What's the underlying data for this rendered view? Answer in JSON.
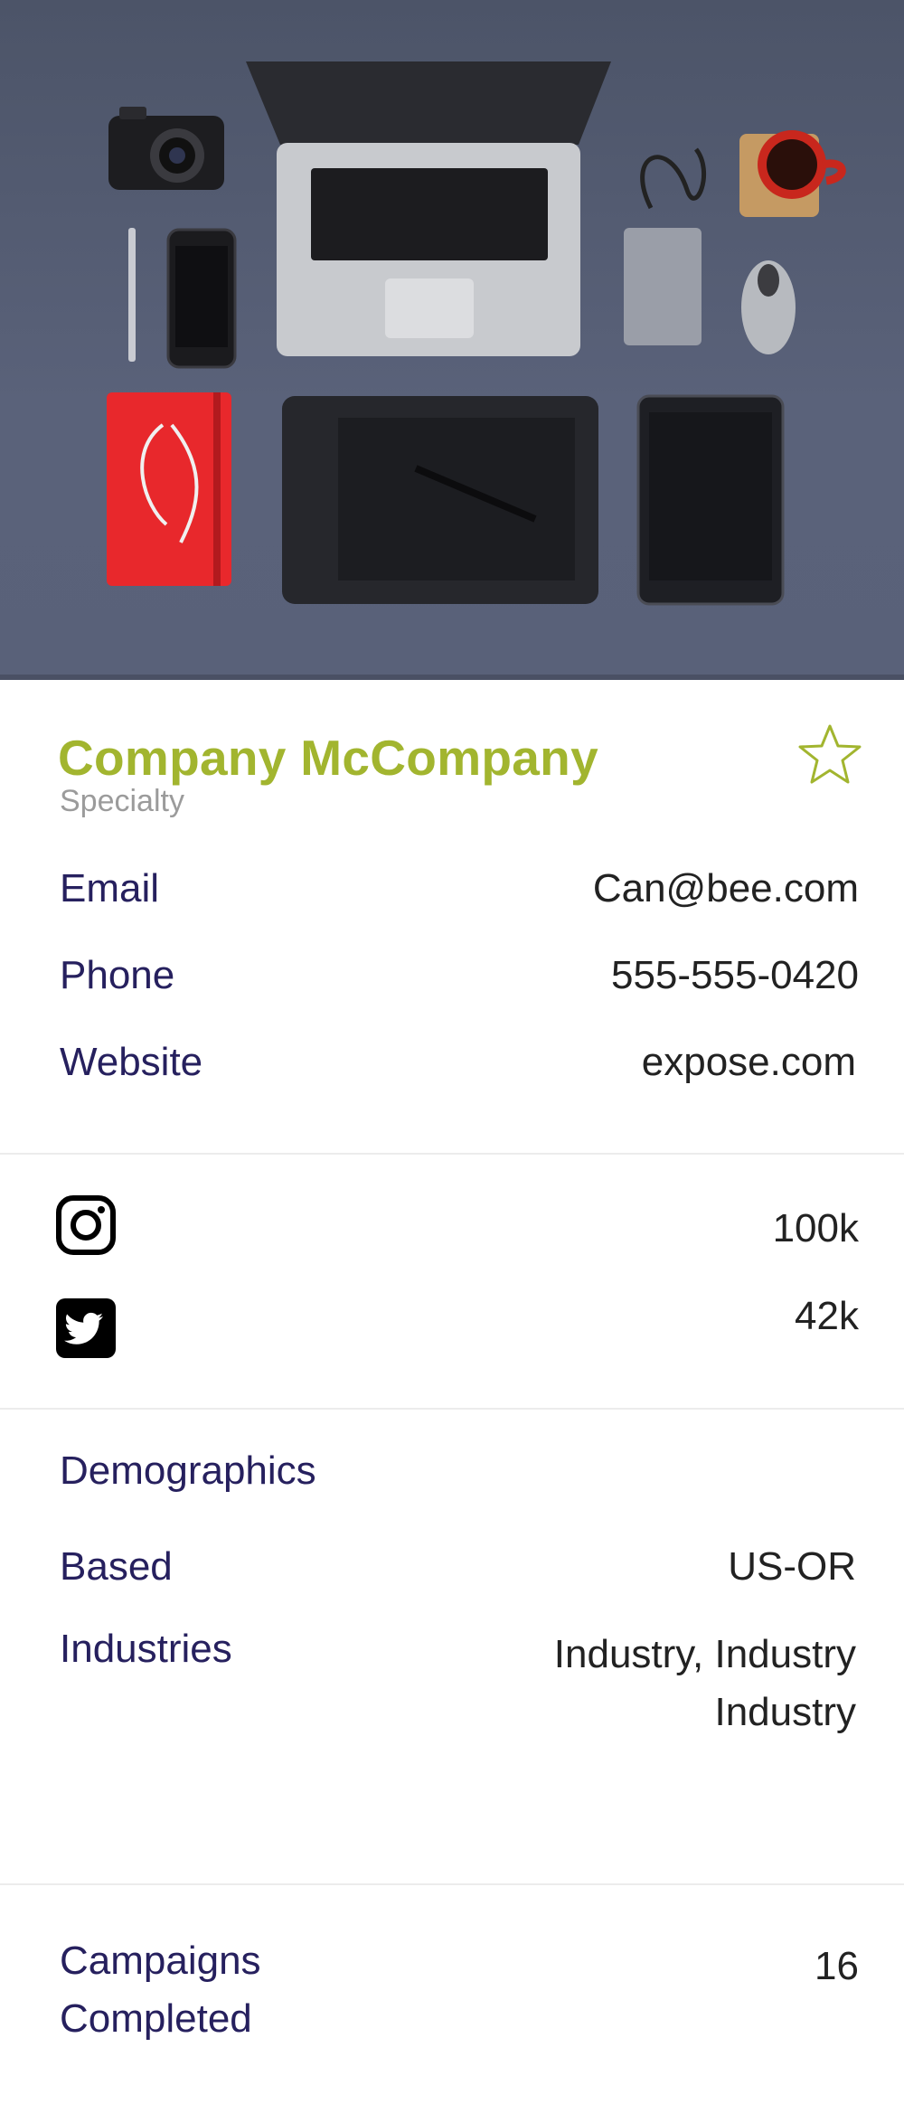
{
  "company": {
    "name": "Company McCompany",
    "specialty": "Specialty"
  },
  "contact": {
    "email_label": "Email",
    "email_value": "Can@bee.com",
    "phone_label": "Phone",
    "phone_value": "555-555-0420",
    "website_label": "Website",
    "website_value": "expose.com"
  },
  "social": {
    "instagram_count": "100k",
    "twitter_count": "42k"
  },
  "demographics": {
    "heading": "Demographics",
    "based_label": "Based",
    "based_value": "US-OR",
    "industries_label": "Industries",
    "industries_line1": "Industry, Industry",
    "industries_line2": "Industry"
  },
  "campaigns": {
    "label_line1": "Campaigns",
    "label_line2": "Completed",
    "value": "16"
  },
  "icons": {
    "favorite": "star-outline-icon",
    "instagram": "instagram-icon",
    "twitter": "twitter-icon"
  },
  "colors": {
    "brand": "#a2b52f",
    "label": "#26205e"
  }
}
